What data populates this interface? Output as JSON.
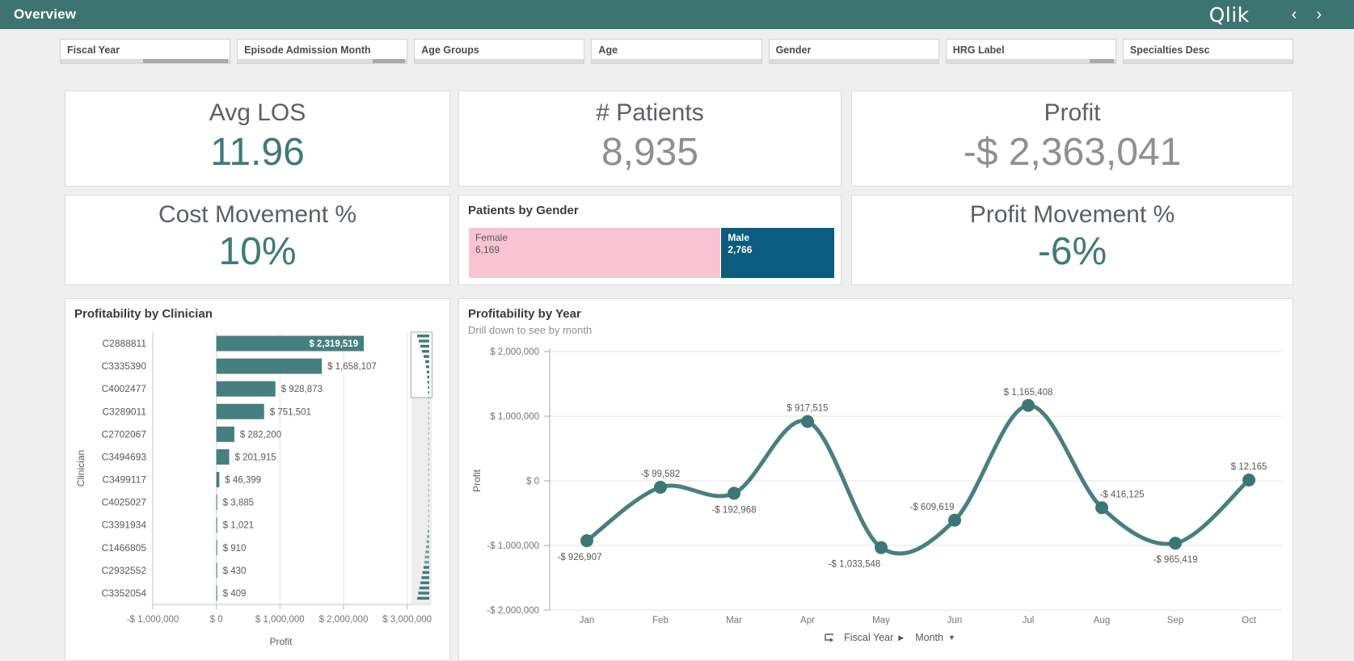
{
  "titlebar": {
    "title": "Overview",
    "logo": "Qlik",
    "prev": "‹",
    "next": "›"
  },
  "filters": [
    {
      "label": "Fiscal Year",
      "thumb": {
        "left": 49,
        "width": 50
      }
    },
    {
      "label": "Episode Admission Month",
      "thumb": {
        "left": 80,
        "width": 19
      }
    },
    {
      "label": "Age Groups",
      "thumb": null
    },
    {
      "label": "Age",
      "thumb": null
    },
    {
      "label": "Gender",
      "thumb": null
    },
    {
      "label": "HRG Label",
      "thumb": {
        "left": 85,
        "width": 14
      }
    },
    {
      "label": "Specialties Desc",
      "thumb": null
    }
  ],
  "kpis": {
    "avg_los": {
      "title": "Avg LOS",
      "value": "11.96",
      "value_color": "#3e7a78"
    },
    "patients": {
      "title": "# Patients",
      "value": "8,935",
      "value_color": "#8f8f8f"
    },
    "profit": {
      "title": "Profit",
      "value": "-$ 2,363,041",
      "value_color": "#8f8f8f"
    },
    "cost_movement": {
      "title": "Cost Movement %",
      "value": "10%",
      "value_color": "#3e7a78"
    },
    "profit_movement": {
      "title": "Profit Movement %",
      "value": "-6%",
      "value_color": "#3e7a78"
    }
  },
  "gender": {
    "title": "Patients by Gender",
    "total": 8935,
    "segments": [
      {
        "label": "Female",
        "value": "6,169",
        "count": 6169,
        "color": "#f8c4d1",
        "text_color": "#595959",
        "bold": false
      },
      {
        "label": "Male",
        "value": "2,766",
        "count": 2766,
        "color": "#0b5c7e",
        "text_color": "#ffffff",
        "bold": true
      }
    ]
  },
  "chart_data": [
    {
      "type": "bar",
      "orientation": "horizontal",
      "title": "Profitability by Clinician",
      "xlabel": "Profit",
      "ylabel": "Clinician",
      "categories": [
        "C2888811",
        "C3335390",
        "C4002477",
        "C3289011",
        "C2702067",
        "C3494693",
        "C3499117",
        "C4025027",
        "C3391934",
        "C1466805",
        "C2932552",
        "C3352054"
      ],
      "values": [
        2319519,
        1658107,
        928873,
        751501,
        282200,
        201915,
        46399,
        3885,
        1021,
        910,
        430,
        409
      ],
      "value_labels": [
        "$ 2,319,519",
        "$ 1,658,107",
        "$ 928,873",
        "$ 751,501",
        "$ 282,200",
        "$ 201,915",
        "$ 46,399",
        "$ 3,885",
        "$ 1,021",
        "$ 910",
        "$ 430",
        "$ 409"
      ],
      "xticks": {
        "labels": [
          "-$ 1,000,000",
          "$ 0",
          "$ 1,000,000",
          "$ 2,000,000",
          "$ 3,000,000"
        ],
        "values": [
          -1000000,
          0,
          1000000,
          2000000,
          3000000
        ]
      },
      "xlim": [
        -1000000,
        3030000
      ],
      "grid": true,
      "bar_color": "#46807e",
      "has_scroll_minimap": true
    },
    {
      "type": "line",
      "title": "Profitability by Year",
      "subtitle": "Drill down to see by month",
      "ylabel": "Profit",
      "categories": [
        "Jan",
        "Feb",
        "Mar",
        "Apr",
        "May",
        "Jun",
        "Jul",
        "Aug",
        "Sep",
        "Oct"
      ],
      "values": [
        -926907,
        -99582,
        -192968,
        917515,
        -1033548,
        -609619,
        1165408,
        -416125,
        -965419,
        12165
      ],
      "point_labels": [
        "-$ 926,907",
        "-$ 99,582",
        "-$ 192,968",
        "$ 917,515",
        "-$ 1,033,548",
        "-$ 609,619",
        "$ 1,165,408",
        "-$ 416,125",
        "-$ 965,419",
        "$ 12,165"
      ],
      "label_pos": [
        "below",
        "above",
        "below",
        "above",
        "below",
        "above",
        "above",
        "above",
        "below",
        "above"
      ],
      "label_dx": [
        -9,
        0,
        0,
        0,
        -33,
        -28,
        0,
        25,
        0,
        0
      ],
      "yticks": {
        "labels": [
          "$ 2,000,000",
          "$ 1,000,000",
          "$ 0",
          "-$ 1,000,000",
          "-$ 2,000,000"
        ],
        "values": [
          2000000,
          1000000,
          0,
          -1000000,
          -2000000
        ]
      },
      "ylim": [
        -2000000,
        2000000
      ],
      "grid": true,
      "legend": false,
      "line_color": "#47807e",
      "point_color": "#3d7775",
      "footer": {
        "breadcrumb": "Fiscal Year",
        "current": "Month"
      }
    }
  ]
}
